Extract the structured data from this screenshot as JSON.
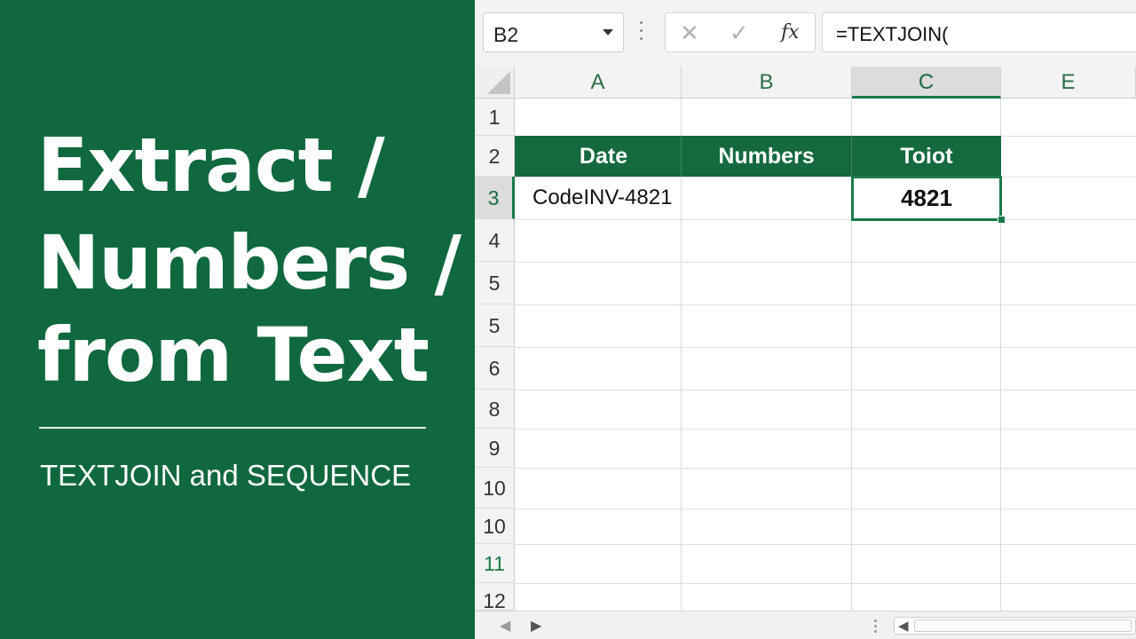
{
  "title": {
    "line1": "Extract /",
    "line2": "Numbers /",
    "line3": "from Text",
    "subtitle": "TEXTJOIN and SEQUENCE"
  },
  "formula_bar": {
    "name_box": "B2",
    "cancel_icon": "✕",
    "enter_icon": "✓",
    "fx_label": "fx",
    "formula": "=TEXTJOIN("
  },
  "columns": [
    "A",
    "B",
    "C",
    "E"
  ],
  "rows": [
    "1",
    "2",
    "3",
    "4",
    "5",
    "5",
    "6",
    "8",
    "9",
    "10",
    "10",
    "11",
    "12"
  ],
  "table": {
    "headers": [
      "Date",
      "Numbers",
      "Toiot"
    ],
    "row3": {
      "A": "CodeINV-4821",
      "B": "",
      "C": "4821"
    }
  },
  "colors": {
    "brand_green": "#10683f",
    "header_green": "#14693e",
    "selection_green": "#1a7a48"
  },
  "bottom_bar": {
    "prev_sheet_icon": "◀",
    "next_sheet_icon": "▶",
    "scroll_left_icon": "◀"
  }
}
